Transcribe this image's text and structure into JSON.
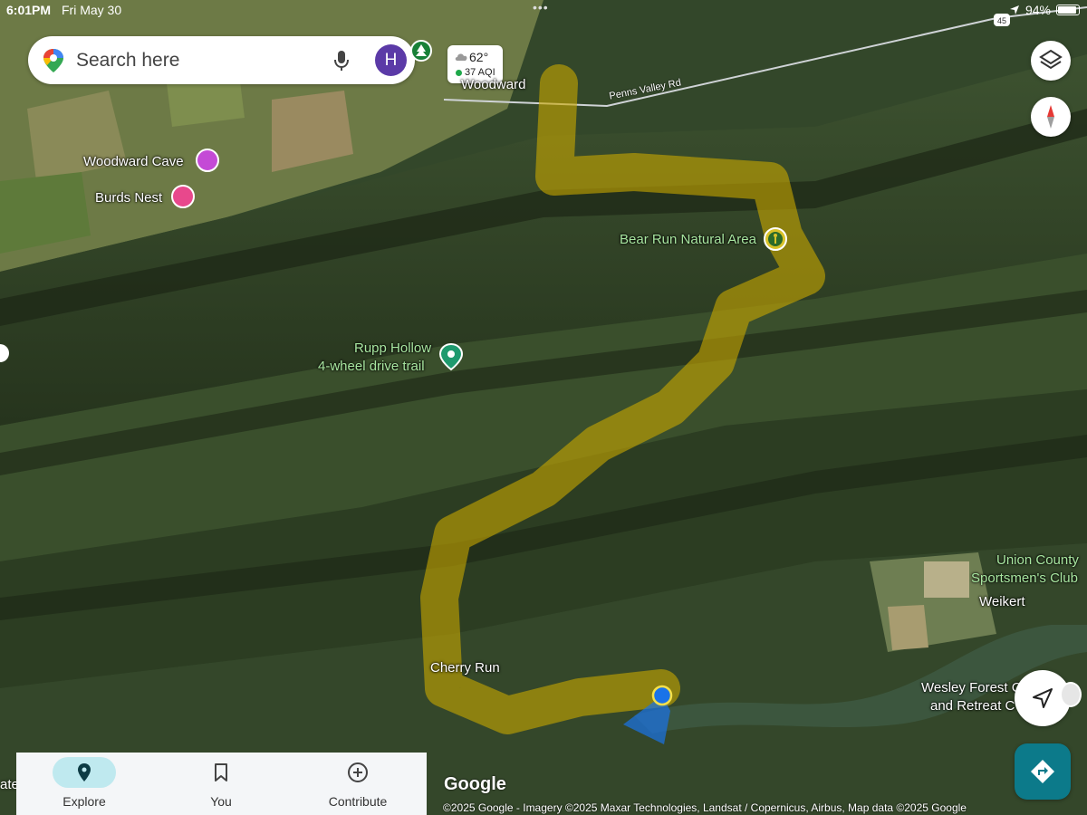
{
  "status": {
    "time": "6:01PM",
    "date": "Fri May 30",
    "battery": "94%",
    "battery_level": 0.94,
    "dots": "•••",
    "badge": "45"
  },
  "search": {
    "placeholder": "Search here",
    "avatar_initial": "H"
  },
  "weather": {
    "temp": "62°",
    "aqi": "37 AQI",
    "icon": "cloud-icon"
  },
  "map": {
    "road_label": "Penns Valley Rd",
    "labels": {
      "woodward": "Woodward",
      "woodward_cave": "Woodward Cave",
      "burds_nest": "Burds Nest",
      "bear_run": "Bear Run Natural Area",
      "rupp_hollow_1": "Rupp Hollow",
      "rupp_hollow_2": "4-wheel drive trail",
      "cherry_run": "Cherry Run",
      "union_county_1": "Union County",
      "union_county_2": "Sportsmen's Club",
      "weikert": "Weikert",
      "wesley_1": "Wesley Forest C",
      "wesley_2": "and Retreat C",
      "edge_left": "ate"
    },
    "colors": {
      "route": "#c9a800",
      "location": "#1a73e8",
      "label_green": "#a8e6a0",
      "accent": "#0c7a8a"
    }
  },
  "nav": {
    "items": [
      {
        "label": "Explore",
        "icon": "pin-icon",
        "active": true
      },
      {
        "label": "You",
        "icon": "bookmark-icon",
        "active": false
      },
      {
        "label": "Contribute",
        "icon": "plus-circle-icon",
        "active": false
      }
    ]
  },
  "footer": {
    "google": "Google",
    "attribution": "©2025 Google - Imagery ©2025 Maxar Technologies, Landsat / Copernicus, Airbus, Map data ©2025 Google"
  }
}
